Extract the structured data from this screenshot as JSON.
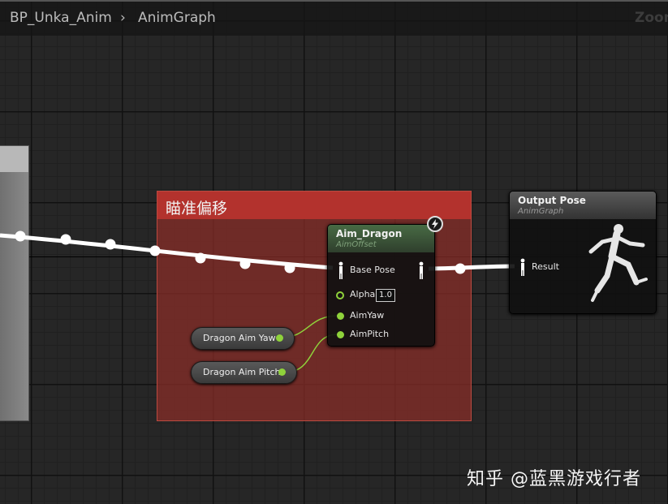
{
  "breadcrumb": {
    "root": "BP_Unka_Anim",
    "separator": "›",
    "leaf": "AnimGraph"
  },
  "zoom_label": "Zoom",
  "comment": {
    "title": "瞄准偏移",
    "color": "#b3322d"
  },
  "aim_node": {
    "title": "Aim_Dragon",
    "subtitle": "AimOffset",
    "header_color": "#3f5a3b",
    "base_pose_label": "Base Pose",
    "alpha_label": "Alpha",
    "alpha_value": "1.0",
    "aim_yaw_label": "AimYaw",
    "aim_pitch_label": "AimPitch",
    "icon": "lightning-icon"
  },
  "output_node": {
    "title": "Output Pose",
    "subtitle": "AnimGraph",
    "header_color": "#444444",
    "result_label": "Result",
    "preview_icon": "running-figure-icon"
  },
  "variables": [
    {
      "label": "Dragon Aim Yaw"
    },
    {
      "label": "Dragon Aim Pitch"
    }
  ],
  "watermark": "知乎 @蓝黑游戏行者",
  "colors": {
    "float_pin": "#8fd23b",
    "exec_wire": "#ffffff",
    "pose_pin": "#ffffff"
  }
}
